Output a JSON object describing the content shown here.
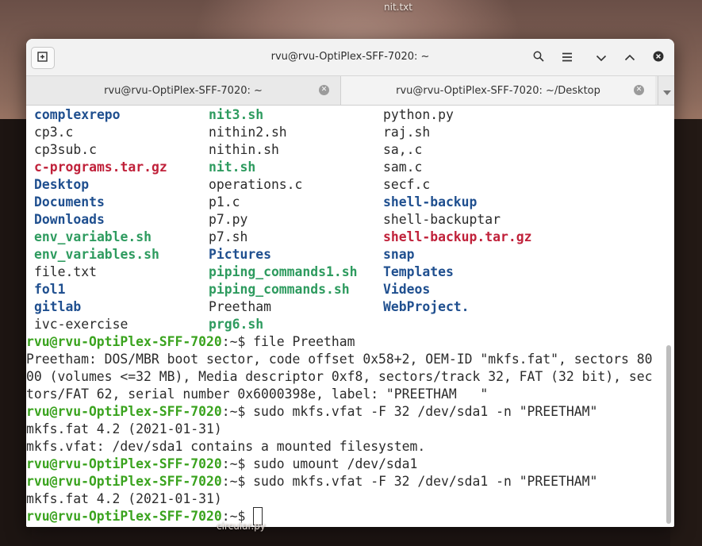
{
  "desktop": {
    "top_label": "nit.txt",
    "bottom_label": "circular.py"
  },
  "window": {
    "title": "rvu@rvu-OptiPlex-SFF-7020: ~",
    "tabs": [
      {
        "label": "rvu@rvu-OptiPlex-SFF-7020: ~"
      },
      {
        "label": "rvu@rvu-OptiPlex-SFF-7020: ~/Desktop"
      }
    ],
    "icons": {
      "new_tab": "new-tab-icon",
      "search": "search-icon",
      "menu": "hamburger-menu-icon",
      "minimize": "chevron-down-icon",
      "maximize": "chevron-up-icon",
      "close": "close-icon"
    }
  },
  "colors": {
    "directory": "#1f4f8f",
    "executable": "#2e9b5f",
    "archive": "#c0213a",
    "prompt": "#3aa31e"
  },
  "listing": [
    [
      {
        "t": "complexrepo",
        "k": "dir"
      },
      {
        "t": "nit3.sh",
        "k": "exe"
      },
      {
        "t": "python.py",
        "k": "plain"
      }
    ],
    [
      {
        "t": "cp3.c",
        "k": "plain"
      },
      {
        "t": "nithin2.sh",
        "k": "plain"
      },
      {
        "t": "raj.sh",
        "k": "plain"
      }
    ],
    [
      {
        "t": "cp3sub.c",
        "k": "plain"
      },
      {
        "t": "nithin.sh",
        "k": "plain"
      },
      {
        "t": "sa,.c",
        "k": "plain"
      }
    ],
    [
      {
        "t": "c-programs.tar.gz",
        "k": "arc"
      },
      {
        "t": "nit.sh",
        "k": "exe"
      },
      {
        "t": "sam.c",
        "k": "plain"
      }
    ],
    [
      {
        "t": "Desktop",
        "k": "dir"
      },
      {
        "t": "operations.c",
        "k": "plain"
      },
      {
        "t": "secf.c",
        "k": "plain"
      }
    ],
    [
      {
        "t": "Documents",
        "k": "dir"
      },
      {
        "t": "p1.c",
        "k": "plain"
      },
      {
        "t": "shell-backup",
        "k": "dir"
      }
    ],
    [
      {
        "t": "Downloads",
        "k": "dir"
      },
      {
        "t": "p7.py",
        "k": "plain"
      },
      {
        "t": "shell-backuptar",
        "k": "plain"
      }
    ],
    [
      {
        "t": "env_variable.sh",
        "k": "exe"
      },
      {
        "t": "p7.sh",
        "k": "plain"
      },
      {
        "t": "shell-backup.tar.gz",
        "k": "arc"
      }
    ],
    [
      {
        "t": "env_variables.sh",
        "k": "exe"
      },
      {
        "t": "Pictures",
        "k": "dir"
      },
      {
        "t": "snap",
        "k": "dir"
      }
    ],
    [
      {
        "t": "file.txt",
        "k": "plain"
      },
      {
        "t": "piping_commands1.sh",
        "k": "exe"
      },
      {
        "t": "Templates",
        "k": "dir"
      }
    ],
    [
      {
        "t": "fol1",
        "k": "dir"
      },
      {
        "t": "piping_commands.sh",
        "k": "exe"
      },
      {
        "t": "Videos",
        "k": "dir"
      }
    ],
    [
      {
        "t": "gitlab",
        "k": "dir"
      },
      {
        "t": "Preetham",
        "k": "plain"
      },
      {
        "t": "WebProject.",
        "k": "dir"
      }
    ],
    [
      {
        "t": "ivc-exercise",
        "k": "plain"
      },
      {
        "t": "prg6.sh",
        "k": "exe"
      },
      {
        "t": "",
        "k": "plain"
      }
    ]
  ],
  "prompt": {
    "user": "rvu@rvu-OptiPlex-SFF-7020",
    "path_suffix": ":~$"
  },
  "session": [
    {
      "type": "cmd",
      "text": " file Preetham"
    },
    {
      "type": "out",
      "text": "Preetham: DOS/MBR boot sector, code offset 0x58+2, OEM-ID \"mkfs.fat\", sectors 80"
    },
    {
      "type": "out",
      "text": "00 (volumes <=32 MB), Media descriptor 0xf8, sectors/track 32, FAT (32 bit), sec"
    },
    {
      "type": "out",
      "text": "tors/FAT 62, serial number 0x6000398e, label: \"PREETHAM   \""
    },
    {
      "type": "cmd",
      "text": " sudo mkfs.vfat -F 32 /dev/sda1 -n \"PREETHAM\""
    },
    {
      "type": "out",
      "text": "mkfs.fat 4.2 (2021-01-31)"
    },
    {
      "type": "out",
      "text": "mkfs.vfat: /dev/sda1 contains a mounted filesystem."
    },
    {
      "type": "cmd",
      "text": " sudo umount /dev/sda1"
    },
    {
      "type": "cmd",
      "text": " sudo mkfs.vfat -F 32 /dev/sda1 -n \"PREETHAM\""
    },
    {
      "type": "out",
      "text": "mkfs.fat 4.2 (2021-01-31)"
    },
    {
      "type": "cursor",
      "text": " "
    }
  ]
}
